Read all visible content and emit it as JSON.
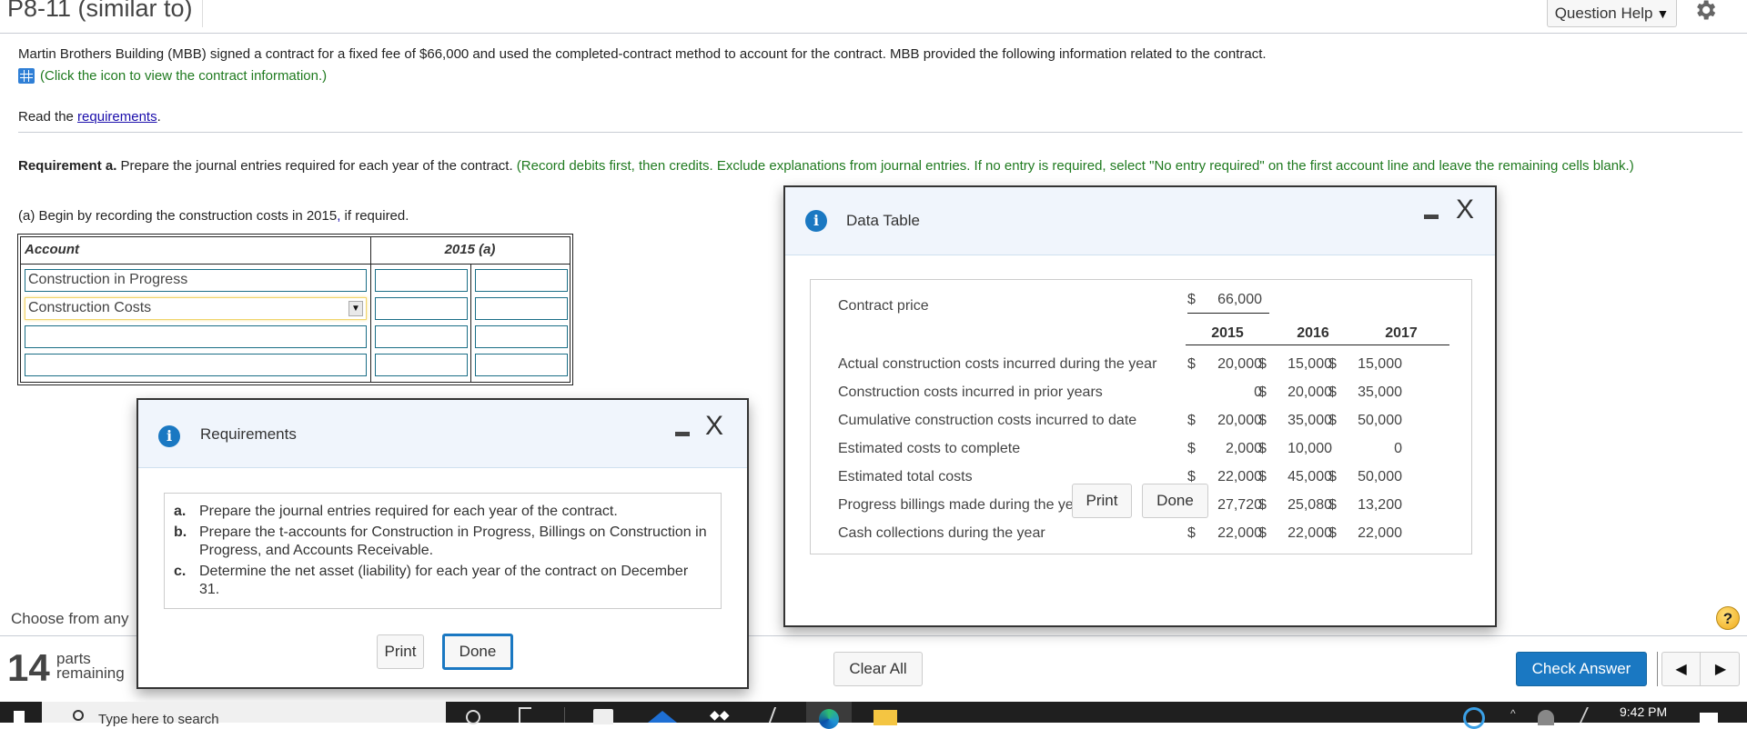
{
  "header": {
    "title": "P8-11 (similar to)",
    "question_help": "Question Help",
    "question_help_arrow": "▼"
  },
  "problem": {
    "intro": "Martin Brothers Building (MBB) signed a contract for a fixed fee of $66,000 and used the completed-contract method to account for the contract. MBB provided the following information related to the contract.",
    "click_icon_text": "(Click the icon to view the contract information.)",
    "read_prefix": "Read the ",
    "read_link": "requirements",
    "read_suffix": ".",
    "req_a_bold": "Requirement a.",
    "req_a_text": " Prepare the journal entries required for each year of the contract. ",
    "req_a_instructions": "(Record debits first, then credits. Exclude explanations from journal entries. If no entry is required, select \"No entry required\" on the first account line and leave the remaining cells blank.)",
    "begin_text_1": "(a) Begin by recording the construction costs in 2015",
    "begin_text_comma": ",",
    "begin_text_2": " if required."
  },
  "journal_table": {
    "account_header": "Account",
    "year_header": "2015 (a)",
    "rows": [
      {
        "account": "Construction in Progress",
        "debit": "",
        "credit": ""
      },
      {
        "account": "Construction Costs",
        "debit": "",
        "credit": "",
        "dropdown_open": false
      },
      {
        "account": "",
        "debit": "",
        "credit": ""
      },
      {
        "account": "",
        "debit": "",
        "credit": ""
      }
    ]
  },
  "data_dialog": {
    "title": "Data Table",
    "minimize": "minimize",
    "close": "X",
    "contract_price_label": "Contract price",
    "contract_price_dollar": "$",
    "contract_price_value": "66,000",
    "years": [
      "2015",
      "2016",
      "2017"
    ],
    "rows": [
      {
        "label": "Actual construction costs incurred during the year",
        "dollars": [
          "$",
          "$",
          "$"
        ],
        "values": [
          "20,000",
          "15,000",
          "15,000"
        ]
      },
      {
        "label": "Construction costs incurred in prior years",
        "dollars": [
          "",
          "$",
          "$"
        ],
        "values": [
          "0",
          "20,000",
          "35,000"
        ]
      },
      {
        "label": "Cumulative construction costs incurred to date",
        "dollars": [
          "$",
          "$",
          "$"
        ],
        "values": [
          "20,000",
          "35,000",
          "50,000"
        ]
      },
      {
        "label": "Estimated costs to complete",
        "dollars": [
          "$",
          "$",
          ""
        ],
        "values": [
          "2,000",
          "10,000",
          "0"
        ]
      },
      {
        "label": "Estimated total costs",
        "dollars": [
          "$",
          "$",
          "$"
        ],
        "values": [
          "22,000",
          "45,000",
          "50,000"
        ]
      },
      {
        "label": "Progress billings made during the year",
        "dollars": [
          "$",
          "$",
          "$"
        ],
        "values": [
          "27,720",
          "25,080",
          "13,200"
        ]
      },
      {
        "label": "Cash collections during the year",
        "dollars": [
          "$",
          "$",
          "$"
        ],
        "values": [
          "22,000",
          "22,000",
          "22,000"
        ]
      }
    ],
    "print": "Print",
    "done": "Done"
  },
  "requirements_dialog": {
    "title": "Requirements",
    "close": "X",
    "items": [
      {
        "letter": "a.",
        "text": "Prepare the journal entries required for each year of the contract."
      },
      {
        "letter": "b.",
        "text": "Prepare the t-accounts for Construction in Progress, Billings on Construction in Progress, and Accounts Receivable."
      },
      {
        "letter": "c.",
        "text": "Determine the net asset (liability) for each year of the contract on December 31."
      }
    ],
    "print": "Print",
    "done": "Done"
  },
  "footer": {
    "choose_text": "Choose from any",
    "parts_count": "14",
    "parts_label_1": "parts",
    "parts_label_2": "remaining",
    "clear_all": "Clear All",
    "check_answer": "Check Answer",
    "help": "?",
    "prev": "◀",
    "next": "▶"
  },
  "taskbar": {
    "search_placeholder": "Type here to search",
    "time": "9:42 PM"
  },
  "colors": {
    "accent_blue": "#1a78c2",
    "instruction_green": "#1f7a1f",
    "link_blue": "#1a0dab",
    "cell_border": "#1a6e86",
    "selected_cell_border": "#f0d46b"
  }
}
